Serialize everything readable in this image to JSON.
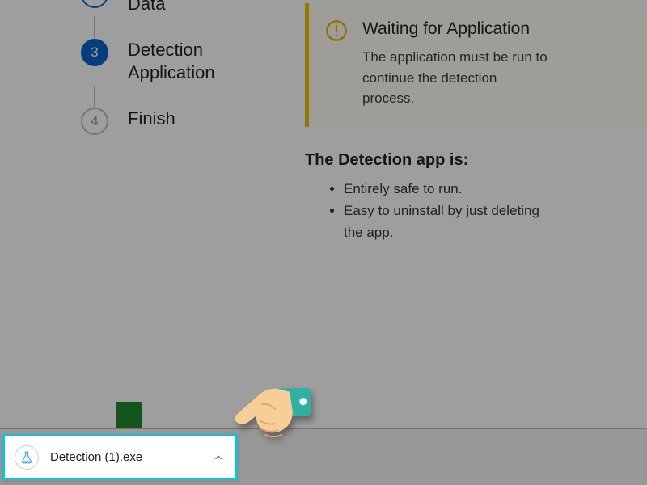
{
  "colors": {
    "accent_blue": "#0a63c9",
    "warning_yellow": "#f2c200",
    "brand_teal": "#19c0d4",
    "accent_green": "#1f8b2e",
    "hand_skin": "#f7cd98",
    "hand_cuff": "#2fb0a0"
  },
  "steps": {
    "s2_partial_label": "Data",
    "s3": {
      "num": "3",
      "label": "Detection Application"
    },
    "s4": {
      "num": "4",
      "label": "Finish"
    }
  },
  "notice": {
    "title": "Waiting for Application",
    "body": "The application must be run to continue the detection process."
  },
  "info": {
    "heading": "The Detection app is:",
    "bullet1": "Entirely safe to run.",
    "bullet2": "Easy to uninstall by just deleting the app."
  },
  "download": {
    "filename": "Detection (1).exe"
  }
}
